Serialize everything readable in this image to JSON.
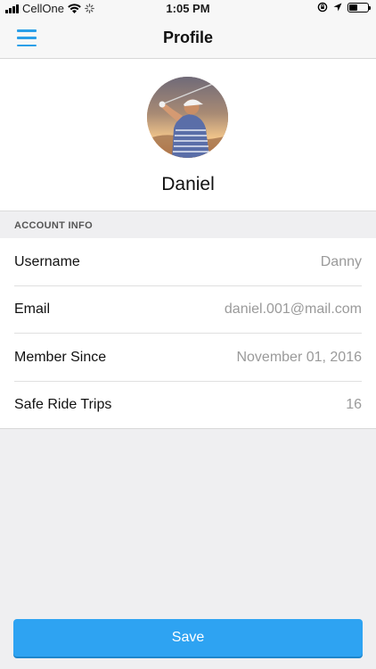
{
  "status_bar": {
    "carrier": "CellOne",
    "time": "1:05 PM"
  },
  "nav": {
    "title": "Profile",
    "menu_icon": "hamburger-menu-icon"
  },
  "profile": {
    "name": "Daniel",
    "avatar_icon": "golfer-photo"
  },
  "account_info": {
    "section_title": "ACCOUNT INFO",
    "rows": [
      {
        "label": "Username",
        "value": "Danny"
      },
      {
        "label": "Email",
        "value": "daniel.001@mail.com"
      },
      {
        "label": "Member Since",
        "value": "November 01, 2016"
      },
      {
        "label": "Safe Ride Trips",
        "value": "16"
      }
    ]
  },
  "actions": {
    "save_label": "Save"
  },
  "colors": {
    "accent": "#2ea3f2",
    "menu_icon": "#2b9fe8",
    "value_text": "#9a9a9a"
  }
}
